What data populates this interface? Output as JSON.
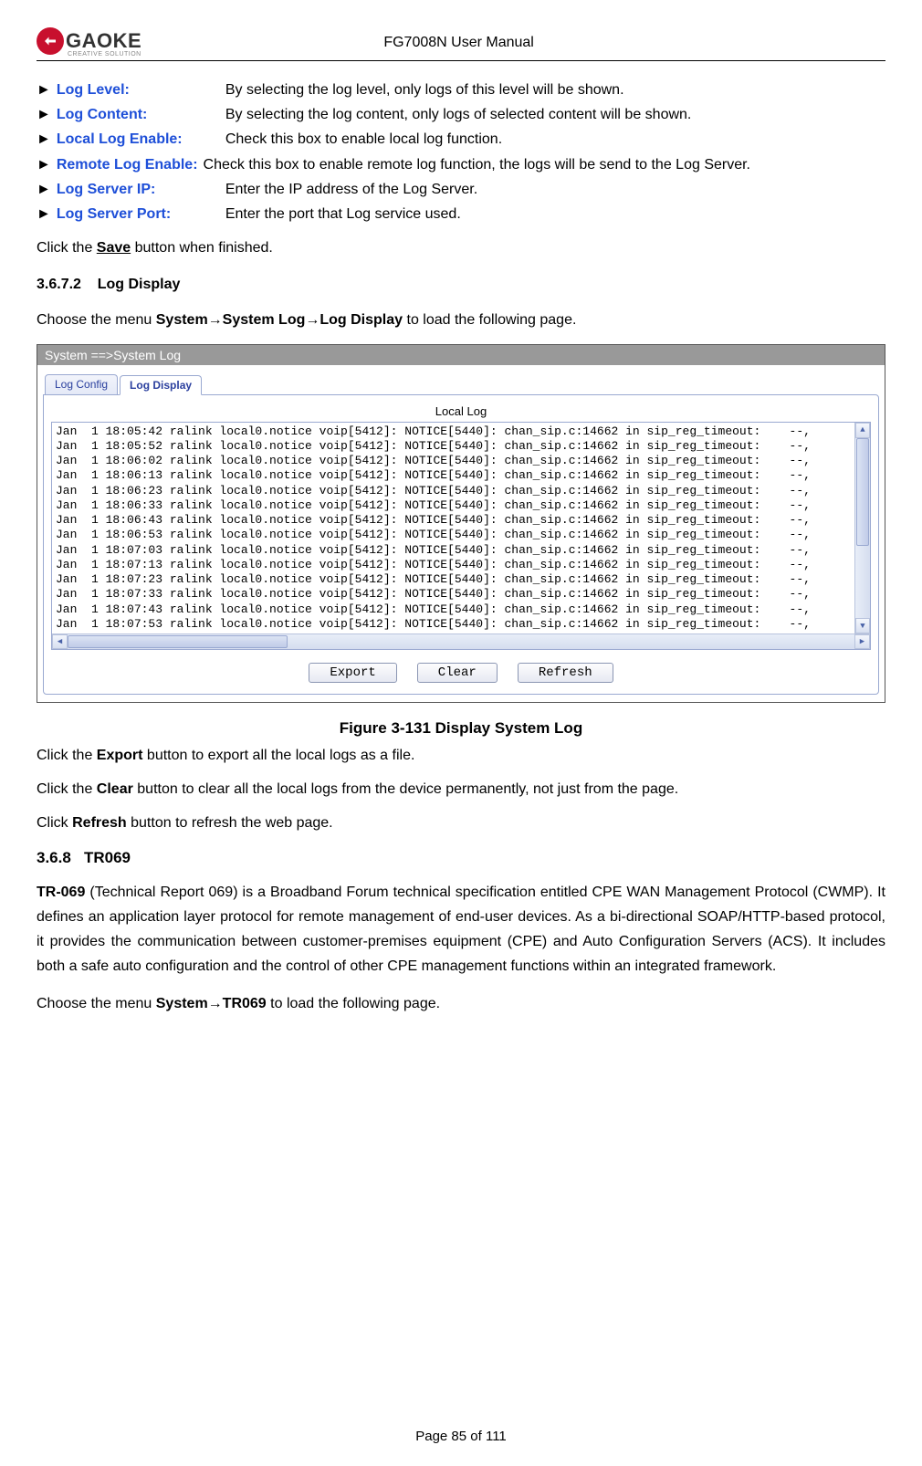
{
  "header": {
    "logo_main": "GAOKE",
    "logo_sub": "CREATIVE SOLUTION",
    "doc_title": "FG7008N User Manual"
  },
  "params": [
    {
      "label": "Log Level:",
      "desc": "By selecting the log level, only logs of this level will be shown."
    },
    {
      "label": "Log Content:",
      "desc": "By selecting the log content, only logs of selected content will be shown."
    },
    {
      "label": "Local Log Enable:",
      "desc": "Check this box to enable local log function."
    },
    {
      "label": "Remote Log Enable:",
      "desc": "Check this box to enable remote log function, the logs will be send to the Log Server."
    },
    {
      "label": "Log Server IP:",
      "desc": "Enter the IP address of the Log Server."
    },
    {
      "label": "Log Server Port:",
      "desc": "Enter the port that Log service used."
    }
  ],
  "intro_tail_prefix": "Click the ",
  "intro_tail_bold": "Save",
  "intro_tail_suffix": " button when finished.",
  "section_3672_num": "3.6.7.2",
  "section_3672_title": "Log Display",
  "nav_sentence": {
    "p1": "Choose the menu ",
    "b1": "System",
    "arrow": "→",
    "b2": "System Log",
    "b3": "Log Display",
    "p2": " to load the following page."
  },
  "screenshot": {
    "title": "System ==>System Log",
    "tabs": {
      "t1": "Log Config",
      "t2": "Log Display"
    },
    "panel_title": "Local Log",
    "log_lines": [
      "Jan  1 18:05:42 ralink local0.notice voip[5412]: NOTICE[5440]: chan_sip.c:14662 in sip_reg_timeout:    --,",
      "Jan  1 18:05:52 ralink local0.notice voip[5412]: NOTICE[5440]: chan_sip.c:14662 in sip_reg_timeout:    --,",
      "Jan  1 18:06:02 ralink local0.notice voip[5412]: NOTICE[5440]: chan_sip.c:14662 in sip_reg_timeout:    --,",
      "Jan  1 18:06:13 ralink local0.notice voip[5412]: NOTICE[5440]: chan_sip.c:14662 in sip_reg_timeout:    --,",
      "Jan  1 18:06:23 ralink local0.notice voip[5412]: NOTICE[5440]: chan_sip.c:14662 in sip_reg_timeout:    --,",
      "Jan  1 18:06:33 ralink local0.notice voip[5412]: NOTICE[5440]: chan_sip.c:14662 in sip_reg_timeout:    --,",
      "Jan  1 18:06:43 ralink local0.notice voip[5412]: NOTICE[5440]: chan_sip.c:14662 in sip_reg_timeout:    --,",
      "Jan  1 18:06:53 ralink local0.notice voip[5412]: NOTICE[5440]: chan_sip.c:14662 in sip_reg_timeout:    --,",
      "Jan  1 18:07:03 ralink local0.notice voip[5412]: NOTICE[5440]: chan_sip.c:14662 in sip_reg_timeout:    --,",
      "Jan  1 18:07:13 ralink local0.notice voip[5412]: NOTICE[5440]: chan_sip.c:14662 in sip_reg_timeout:    --,",
      "Jan  1 18:07:23 ralink local0.notice voip[5412]: NOTICE[5440]: chan_sip.c:14662 in sip_reg_timeout:    --,",
      "Jan  1 18:07:33 ralink local0.notice voip[5412]: NOTICE[5440]: chan_sip.c:14662 in sip_reg_timeout:    --,",
      "Jan  1 18:07:43 ralink local0.notice voip[5412]: NOTICE[5440]: chan_sip.c:14662 in sip_reg_timeout:    --,",
      "Jan  1 18:07:53 ralink local0.notice voip[5412]: NOTICE[5440]: chan_sip.c:14662 in sip_reg_timeout:    --,"
    ],
    "buttons": {
      "export": "Export",
      "clear": "Clear",
      "refresh": "Refresh"
    }
  },
  "figure_caption": "Figure 3-131  Display System Log",
  "after_fig": {
    "l1_pre": "Click the ",
    "l1_b": "Export",
    "l1_post": " button to export all the local logs as a file.",
    "l2_pre": "Click the ",
    "l2_b": "Clear",
    "l2_post": " button to clear all the local logs from the device permanently, not just from the page.",
    "l3_pre": "Click ",
    "l3_b": "Refresh",
    "l3_post": " button to refresh the web page."
  },
  "section_368_num": "3.6.8",
  "section_368_title": "TR069",
  "tr069_para_b": "TR-069",
  "tr069_para": " (Technical Report 069) is a Broadband Forum technical specification entitled CPE WAN Management Protocol (CWMP). It defines an application layer protocol for remote management of end-user devices. As a bi-directional SOAP/HTTP-based protocol, it provides the communication between customer-premises equipment (CPE) and Auto Configuration Servers (ACS). It includes both a safe auto configuration and the control of other CPE management functions within an integrated framework.",
  "tr069_nav": {
    "p1": "Choose the menu ",
    "b1": "System",
    "arrow": "→",
    "b2": "TR069",
    "p2": " to load the following page."
  },
  "footer": "Page 85 of 111"
}
